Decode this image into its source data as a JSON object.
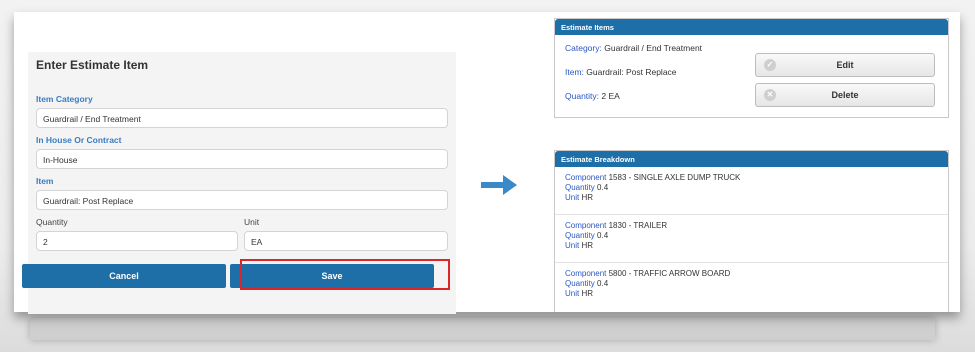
{
  "left_form": {
    "title": "Enter Estimate Item",
    "item_category_label": "Item Category",
    "item_category_value": "Guardrail / End Treatment",
    "in_house_label": "In House Or Contract",
    "in_house_value": "In-House",
    "item_label": "Item",
    "item_value": "Guardrail: Post Replace",
    "quantity_label": "Quantity",
    "quantity_value": "2",
    "unit_label": "Unit",
    "unit_value": "EA",
    "cancel_label": "Cancel",
    "save_label": "Save"
  },
  "estimate_items": {
    "header": "Estimate Items",
    "category_key": "Category:",
    "category_value": "Guardrail / End Treatment",
    "item_key": "Item:",
    "item_value": "Guardrail: Post Replace",
    "quantity_key": "Quantity:",
    "quantity_value": "2  EA",
    "edit_label": "Edit",
    "delete_label": "Delete"
  },
  "estimate_breakdown": {
    "header": "Estimate Breakdown",
    "component_key": "Component",
    "quantity_key": "Quantity",
    "unit_key": "Unit",
    "items": [
      {
        "component": "1583 - SINGLE AXLE DUMP TRUCK",
        "quantity": "0.4",
        "unit": "HR"
      },
      {
        "component": "1830 - TRAILER",
        "quantity": "0.4",
        "unit": "HR"
      },
      {
        "component": "5800 - TRAFFIC ARROW BOARD",
        "quantity": "0.4",
        "unit": "HR"
      }
    ]
  },
  "colors": {
    "accent": "#1e6fa8",
    "label_blue": "#3a7cc2",
    "highlight_red": "#d9262b"
  },
  "icons": {
    "arrow": "right-arrow-icon",
    "edit": "check-circle-icon",
    "delete": "x-circle-icon"
  }
}
